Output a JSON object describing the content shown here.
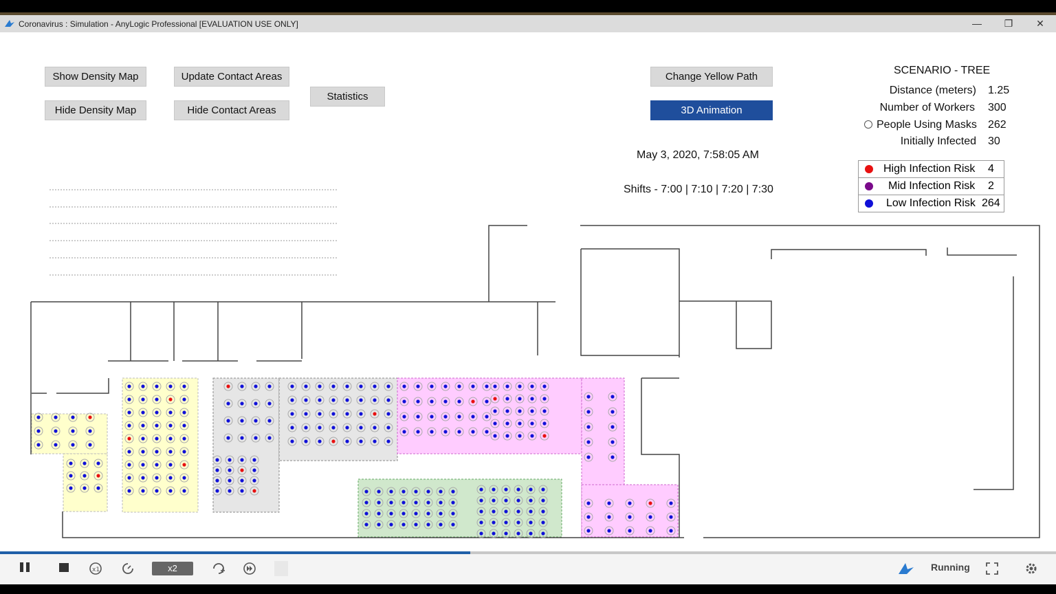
{
  "window": {
    "title": "Coronavirus : Simulation - AnyLogic Professional [EVALUATION USE ONLY]",
    "minimize": "—",
    "restore": "❐",
    "close": "✕"
  },
  "buttons": {
    "show_density": "Show Density Map",
    "hide_density": "Hide Density Map",
    "update_contact": "Update Contact Areas",
    "hide_contact": "Hide Contact Areas",
    "statistics": "Statistics",
    "change_path": "Change Yellow Path",
    "animation_3d": "3D Animation"
  },
  "scenario": {
    "title": "SCENARIO - TREE",
    "distance_label": "Distance (meters)",
    "distance_value": "1.25",
    "workers_label": "Number of Workers",
    "workers_value": "300",
    "masks_label": "People Using Masks",
    "masks_value": "262",
    "infected_label": "Initially Infected",
    "infected_value": "30"
  },
  "risk_legend": [
    {
      "label": "High Infection Risk",
      "value": "4",
      "color": "#e81010"
    },
    {
      "label": "Mid Infection Risk",
      "value": "2",
      "color": "#7a0a8a"
    },
    {
      "label": "Low Infection Risk",
      "value": "264",
      "color": "#1010d8"
    }
  ],
  "datetime": "May 3, 2020, 7:58:05 AM",
  "shifts": "Shifts - 7:00 | 7:10 | 7:20 | 7:30",
  "controls": {
    "speed": "x2",
    "status": "Running"
  },
  "colors": {
    "accent": "#1f4e9c",
    "yellow_zone": "#ffffcc",
    "gray_zone": "#e6e6e6",
    "pink_zone": "#ffccff",
    "green_zone": "#d0e8cc"
  },
  "progress": 0.445
}
